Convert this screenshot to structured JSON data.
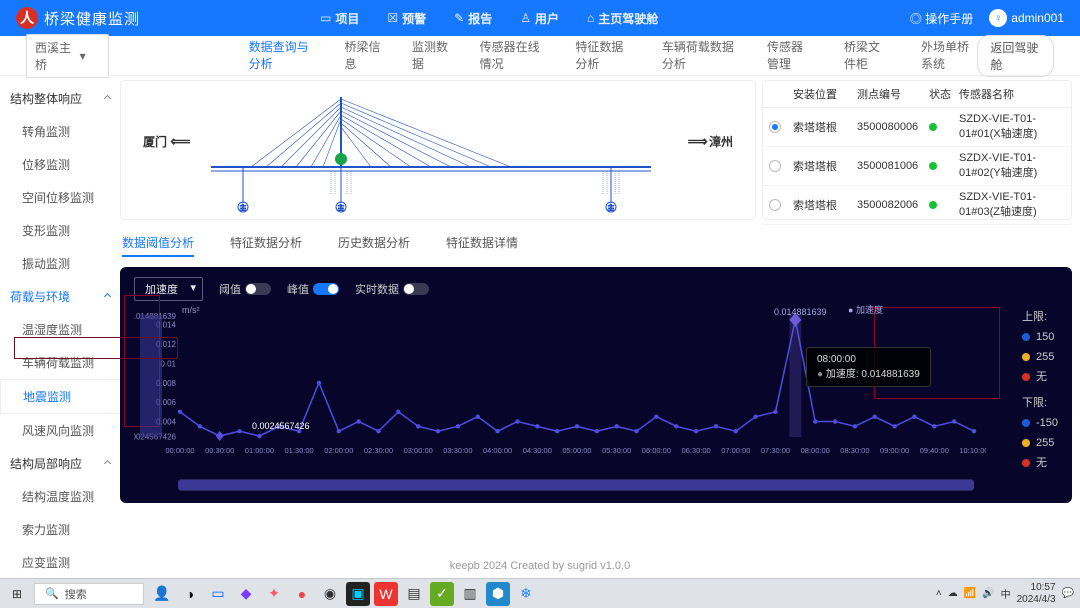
{
  "header": {
    "brand": "桥梁健康监测",
    "nav": [
      "项目",
      "预警",
      "报告",
      "用户",
      "主页驾驶舱"
    ],
    "manual": "操作手册",
    "user": "admin001"
  },
  "subbar": {
    "bridge": "西溪主桥",
    "tabs": [
      "数据查询与分析",
      "桥梁信息",
      "监测数据",
      "传感器在线情况",
      "特征数据分析",
      "车辆荷载数据分析",
      "传感器管理",
      "桥梁文件柜",
      "外场单桥系统"
    ],
    "active": 0,
    "back": "返回驾驶舱"
  },
  "sidebar": {
    "groups": [
      {
        "label": "结构整体响应",
        "items": [
          "转角监测",
          "位移监测",
          "空间位移监测",
          "变形监测",
          "振动监测"
        ]
      },
      {
        "label": "荷载与环境",
        "items": [
          "温湿度监测",
          "车辆荷载监测",
          "地震监测",
          "风速风向监测"
        ],
        "selected": 2
      },
      {
        "label": "结构局部响应",
        "items": [
          "结构温度监测",
          "索力监测",
          "应变监测"
        ]
      }
    ]
  },
  "bridge_view": {
    "left": "厦门",
    "right": "漳州"
  },
  "sensor_table": {
    "headers": [
      "安装位置",
      "测点编号",
      "状态",
      "传感器名称"
    ],
    "rows": [
      {
        "checked": true,
        "loc": "索塔塔根",
        "code": "3500080006",
        "status": "ok",
        "name": "SZDX-VIE-T01-01#01(X轴速度)"
      },
      {
        "checked": false,
        "loc": "索塔塔根",
        "code": "3500081006",
        "status": "ok",
        "name": "SZDX-VIE-T01-01#02(Y轴速度)"
      },
      {
        "checked": false,
        "loc": "索塔塔根",
        "code": "3500082006",
        "status": "ok",
        "name": "SZDX-VIE-T01-01#03(Z轴速度)"
      }
    ]
  },
  "chart_tabs": {
    "items": [
      "数据阈值分析",
      "特征数据分析",
      "历史数据分析",
      "特征数据详情"
    ],
    "active": 0
  },
  "chart_toolbar": {
    "series_sel": "加速度",
    "toggles": [
      {
        "label": "阈值",
        "on": false
      },
      {
        "label": "峰值",
        "on": true
      },
      {
        "label": "实时数据",
        "on": false
      }
    ]
  },
  "legend": {
    "series_name": "加速度",
    "upper_label": "上限:",
    "lower_label": "下限:",
    "limits_upper": [
      {
        "color": "#1e5bd6",
        "value": "150"
      },
      {
        "color": "#f2b01e",
        "value": "255"
      },
      {
        "color": "#d93025",
        "value": "无"
      }
    ],
    "limits_lower": [
      {
        "color": "#1e5bd6",
        "value": "-150"
      },
      {
        "color": "#f2b01e",
        "value": "255"
      },
      {
        "color": "#d93025",
        "value": "无"
      }
    ]
  },
  "chart_data": {
    "type": "line",
    "title": "加速度",
    "ylabel": "m/s²",
    "ylim": [
      0.0024,
      0.015
    ],
    "yticks": [
      0.0024567426,
      0.004,
      0.006,
      0.008,
      0.01,
      0.012,
      0.014,
      0.014881639
    ],
    "categories": [
      "00:00:00",
      "00:30:00",
      "01:00:00",
      "01:30:00",
      "02:00:00",
      "02:30:00",
      "03:00:00",
      "03:30:00",
      "04:00:00",
      "04:30:00",
      "05:00:00",
      "05:30:00",
      "06:00:00",
      "06:30:00",
      "07:00:00",
      "07:30:00",
      "08:00:00",
      "08:30:00",
      "09:00:00",
      "09:40:00",
      "10:10:00"
    ],
    "series": [
      {
        "name": "加速度",
        "values": [
          0.005,
          0.0035,
          0.0025,
          0.003,
          0.0025,
          0.0035,
          0.003,
          0.008,
          0.003,
          0.004,
          0.003,
          0.005,
          0.0035,
          0.003,
          0.0035,
          0.0045,
          0.003,
          0.004,
          0.0035,
          0.003,
          0.0035,
          0.003,
          0.0035,
          0.003,
          0.0045,
          0.0035,
          0.003,
          0.0035,
          0.003,
          0.0045,
          0.005,
          0.0145,
          0.004,
          0.004,
          0.0035,
          0.0045,
          0.0035,
          0.0045,
          0.0035,
          0.004,
          0.003
        ]
      }
    ],
    "peak": {
      "x": "08:00:00",
      "value": 0.014881639,
      "label": "0.014881639"
    },
    "trough": {
      "x": "01:15:00",
      "value": 0.0024567426,
      "label": "0.0024567426"
    },
    "tooltip": {
      "time": "08:00:00",
      "metric": "加速度",
      "value": "0.014881639"
    }
  },
  "footer": "keepb 2024 Created by sugrid v1.0.0",
  "taskbar": {
    "search_placeholder": "搜索",
    "clock": {
      "time": "10:57",
      "date": "2024/4/3"
    }
  }
}
